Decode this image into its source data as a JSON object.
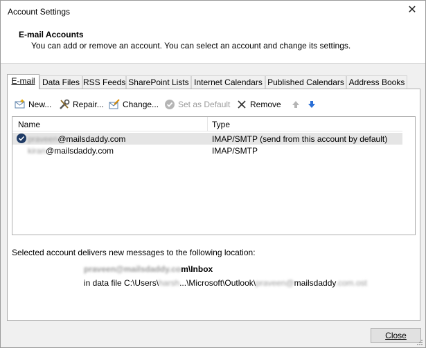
{
  "window": {
    "title": "Account Settings"
  },
  "header": {
    "title": "E-mail Accounts",
    "description": "You can add or remove an account. You can select an account and change its settings."
  },
  "tabs": [
    {
      "label": "E-mail",
      "active": true
    },
    {
      "label": "Data Files"
    },
    {
      "label": "RSS Feeds"
    },
    {
      "label": "SharePoint Lists"
    },
    {
      "label": "Internet Calendars"
    },
    {
      "label": "Published Calendars"
    },
    {
      "label": "Address Books"
    }
  ],
  "toolbar": {
    "new": "New...",
    "repair": "Repair...",
    "change": "Change...",
    "set_default": "Set as Default",
    "remove": "Remove",
    "move_up_icon": "arrow-up-icon",
    "move_down_icon": "arrow-down-icon"
  },
  "list": {
    "col_name": "Name",
    "col_type": "Type",
    "rows": [
      {
        "name_blur": "praveen",
        "name_rest": "@mailsdaddy.com",
        "type": "IMAP/SMTP (send from this account by default)",
        "selected": true,
        "default": true
      },
      {
        "name_blur": "kiran",
        "name_rest": "@mailsdaddy.com",
        "type": "IMAP/SMTP"
      }
    ]
  },
  "delivery": {
    "label": "Selected account delivers new messages to the following location:",
    "folder_blur": "praveen@mailsdaddy.co",
    "folder_rest": "m\\Inbox",
    "path_prefix": "in data file C:\\Users\\",
    "path_user_blur": "harsh",
    "path_mid": "...\\Microsoft\\Outlook\\",
    "path_blur": "praveen@",
    "path_rest": "mailsdaddy",
    "path_suffix_blur": ".com.ost"
  },
  "buttons": {
    "close": "Close"
  },
  "colors": {
    "selected_row": "#e5e5e5",
    "default_check": "#1f3b66",
    "arrow_blue": "#2a6fd6"
  }
}
